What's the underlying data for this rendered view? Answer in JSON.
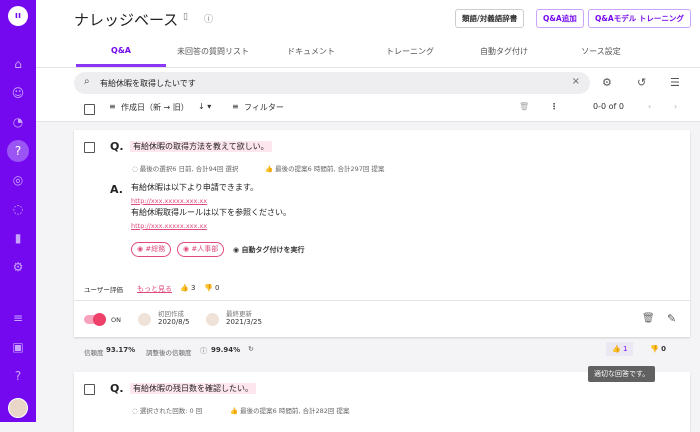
{
  "header": {
    "title": "ナレッジベース",
    "buttons": [
      "類語/対義語辞書",
      "Q&A追加",
      "Q&Aモデル トレーニング"
    ]
  },
  "tabs": [
    "Q&A",
    "未回答の質問リスト",
    "ドキュメント",
    "トレーニング",
    "自動タグ付け",
    "ソース設定"
  ],
  "search": {
    "value": "有給休暇を取得したいです"
  },
  "toolbar": {
    "sort": "作成日（新 → 旧）",
    "filter": "フィルター",
    "pagination": "0-0 of 0"
  },
  "items": [
    {
      "question": "有給休暇の取得方法を教えて欲しい。",
      "meta_selected": "最後の選択6 日前, 合計94回 選択",
      "meta_suggested": "最後の提案6 時間前, 合計297回 提案",
      "answer_lines": [
        "有給休暇は以下より申請できます。",
        "http://xxx.xxxxx.xxx.xx",
        "有給休暇取得ルールは以下を参照ください。",
        "http://xxx.xxxxx.xxx.xx"
      ],
      "tags": [
        "#総務",
        "#人事部"
      ],
      "auto_tag": "自動タグ付けを実行",
      "rating_label": "ユーザー評価",
      "more": "もっと見る",
      "up": "3",
      "down": "0",
      "toggle": "ON",
      "created_label": "初回作成",
      "created": "2020/8/5",
      "updated_label": "最終更新",
      "updated": "2021/3/25",
      "confidence_label": "信頼度",
      "confidence": "93.17%",
      "adjusted_label": "調整後の信頼度",
      "adjusted": "99.94%",
      "vote_up": "1",
      "vote_down": "0"
    },
    {
      "question": "有給休暇の残日数を確認したい。",
      "meta_selected": "選択された回数: 0 回",
      "meta_suggested": "最後の提案6 時間前, 合計282回 提案"
    }
  ],
  "tooltip": "適切な回答です。",
  "colors": {
    "accent": "#7409ef",
    "pink": "#e04b7c"
  }
}
